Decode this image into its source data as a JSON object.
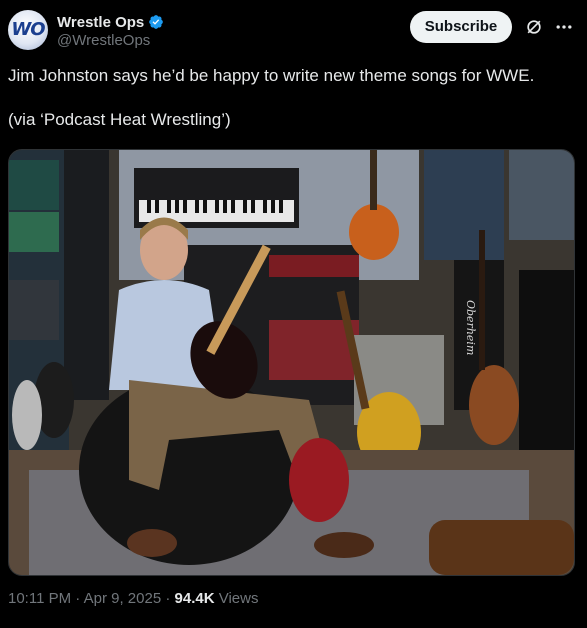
{
  "account": {
    "display_name": "Wrestle Ops",
    "handle": "@WrestleOps",
    "avatar_text": "WO",
    "verified": true
  },
  "actions": {
    "subscribe_label": "Subscribe",
    "grok_icon": "grok-icon",
    "more_icon": "more-horizontal-icon"
  },
  "tweet": {
    "line1": "Jim Johnston says he’d be happy to write new theme songs for WWE.",
    "line2": "(via ‘Podcast Heat Wrestling’)"
  },
  "media": {
    "type": "photo",
    "brand_text": "Oberheim"
  },
  "meta": {
    "time": "10:11 PM",
    "separator": " · ",
    "date": "Apr 9, 2025",
    "views_count": "94.4K",
    "views_label": " Views"
  },
  "colors": {
    "background": "#000000",
    "text": "#e7e9ea",
    "secondary_text": "#71767b",
    "verified_badge": "#1d9bf0",
    "button_bg": "#eff3f4"
  }
}
